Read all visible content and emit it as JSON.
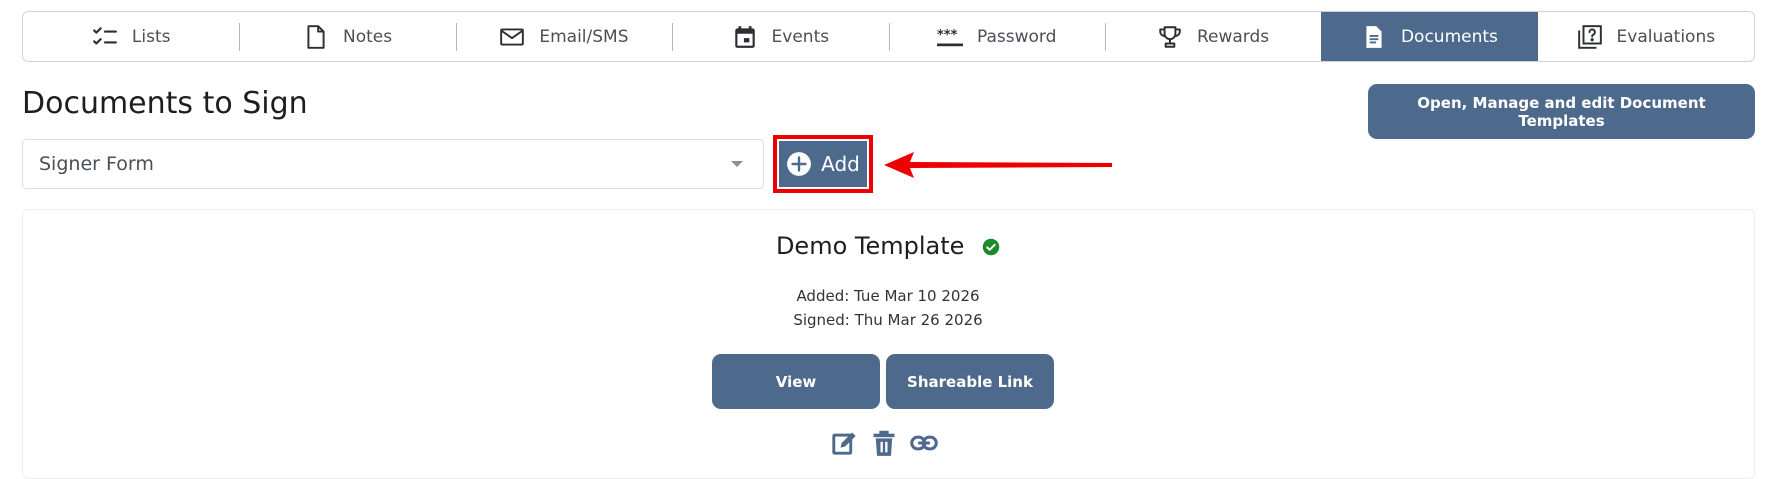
{
  "tabs": [
    {
      "label": "Lists",
      "icon": "checklist-icon",
      "active": false
    },
    {
      "label": "Notes",
      "icon": "document-icon",
      "active": false
    },
    {
      "label": "Email/SMS",
      "icon": "envelope-icon",
      "active": false
    },
    {
      "label": "Events",
      "icon": "calendar-icon",
      "active": false
    },
    {
      "label": "Password",
      "icon": "password-icon",
      "active": false
    },
    {
      "label": "Rewards",
      "icon": "trophy-icon",
      "active": false
    },
    {
      "label": "Documents",
      "icon": "file-text-icon",
      "active": true
    },
    {
      "label": "Evaluations",
      "icon": "question-copy-icon",
      "active": false
    }
  ],
  "page": {
    "title": "Documents to Sign",
    "templates_button": "Open, Manage and edit Document Templates"
  },
  "form": {
    "selected_value": "Signer Form",
    "add_label": "Add"
  },
  "document": {
    "title": "Demo Template",
    "added": "Added: Tue Mar 10 2026",
    "signed": "Signed: Thu Mar 26 2026",
    "view_label": "View",
    "share_label": "Shareable Link"
  },
  "colors": {
    "accent": "#4d6a8c",
    "highlight": "#ee0000",
    "success": "#1a8a2a"
  }
}
